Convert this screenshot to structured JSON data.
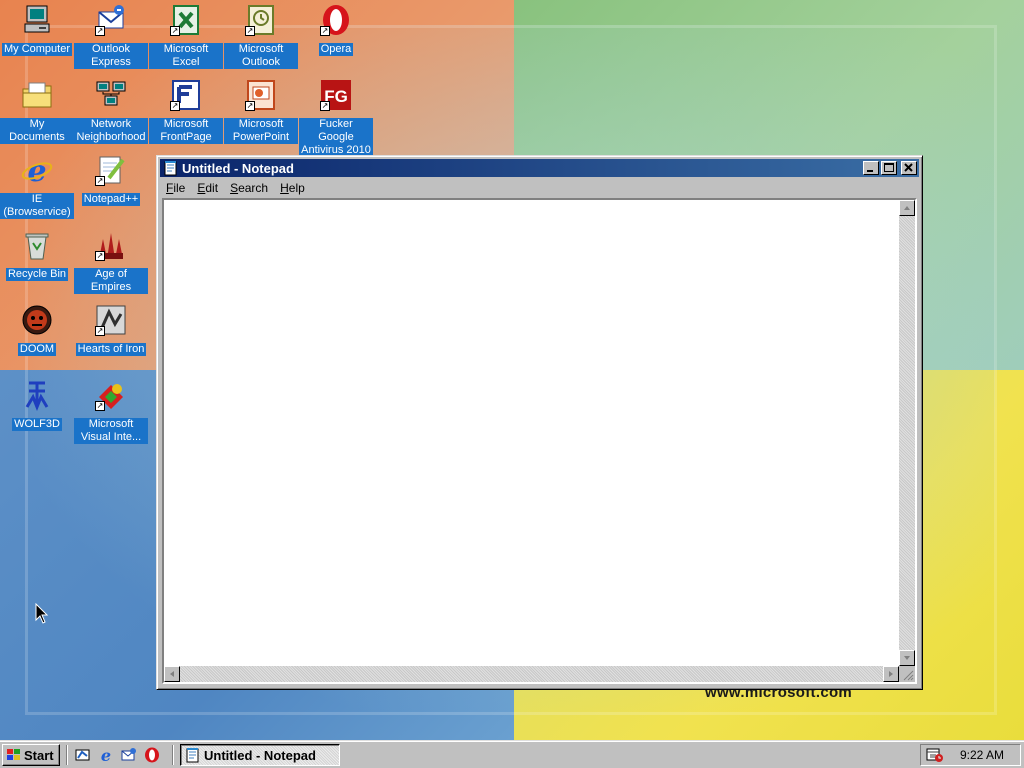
{
  "desktop": {
    "wallpaper_text": "www.microsoft.com",
    "icons": [
      {
        "label": "My Computer",
        "icon": "my-computer-icon"
      },
      {
        "label": "Outlook Express",
        "icon": "outlook-express-icon"
      },
      {
        "label": "Microsoft Excel",
        "icon": "excel-icon"
      },
      {
        "label": "Microsoft Outlook",
        "icon": "outlook-icon"
      },
      {
        "label": "Opera",
        "icon": "opera-icon"
      },
      {
        "label": "My Documents",
        "icon": "my-documents-icon"
      },
      {
        "label": "Network Neighborhood",
        "icon": "network-neighborhood-icon"
      },
      {
        "label": "Microsoft FrontPage",
        "icon": "frontpage-icon"
      },
      {
        "label": "Microsoft PowerPoint",
        "icon": "powerpoint-icon"
      },
      {
        "label": "Fucker Google Antivirus 2010",
        "icon": "antivirus-icon"
      },
      {
        "label": "IE (Browservice)",
        "icon": "internet-explorer-icon"
      },
      {
        "label": "Notepad++",
        "icon": "notepadpp-icon"
      },
      {
        "label": "Recycle Bin",
        "icon": "recycle-bin-icon"
      },
      {
        "label": "Age of Empires",
        "icon": "age-of-empires-icon"
      },
      {
        "label": "DOOM",
        "icon": "doom-icon"
      },
      {
        "label": "Hearts of Iron",
        "icon": "hearts-of-iron-icon"
      },
      {
        "label": "WOLF3D",
        "icon": "wolf3d-icon"
      },
      {
        "label": "Microsoft Visual Inte...",
        "icon": "visual-interdev-icon"
      }
    ]
  },
  "notepad": {
    "title": "Untitled - Notepad",
    "menu": [
      {
        "label": "File",
        "accel": "F",
        "rest": "ile"
      },
      {
        "label": "Edit",
        "accel": "E",
        "rest": "dit"
      },
      {
        "label": "Search",
        "accel": "S",
        "rest": "earch"
      },
      {
        "label": "Help",
        "accel": "H",
        "rest": "elp"
      }
    ],
    "content": ""
  },
  "taskbar": {
    "start_label": "Start",
    "quick_launch": [
      "show-desktop-icon",
      "internet-explorer-icon",
      "outlook-express-icon",
      "opera-icon"
    ],
    "tasks": [
      {
        "label": "Untitled - Notepad",
        "icon": "notepad-icon",
        "active": true
      }
    ],
    "tray_icons": [
      "scheduler-icon"
    ],
    "clock": "9:22 AM"
  },
  "colors": {
    "title_active_start": "#0a246a",
    "title_active_end": "#3a6ea5",
    "icon_label_bg": "#1a73c9",
    "face": "#c0c0c0"
  }
}
